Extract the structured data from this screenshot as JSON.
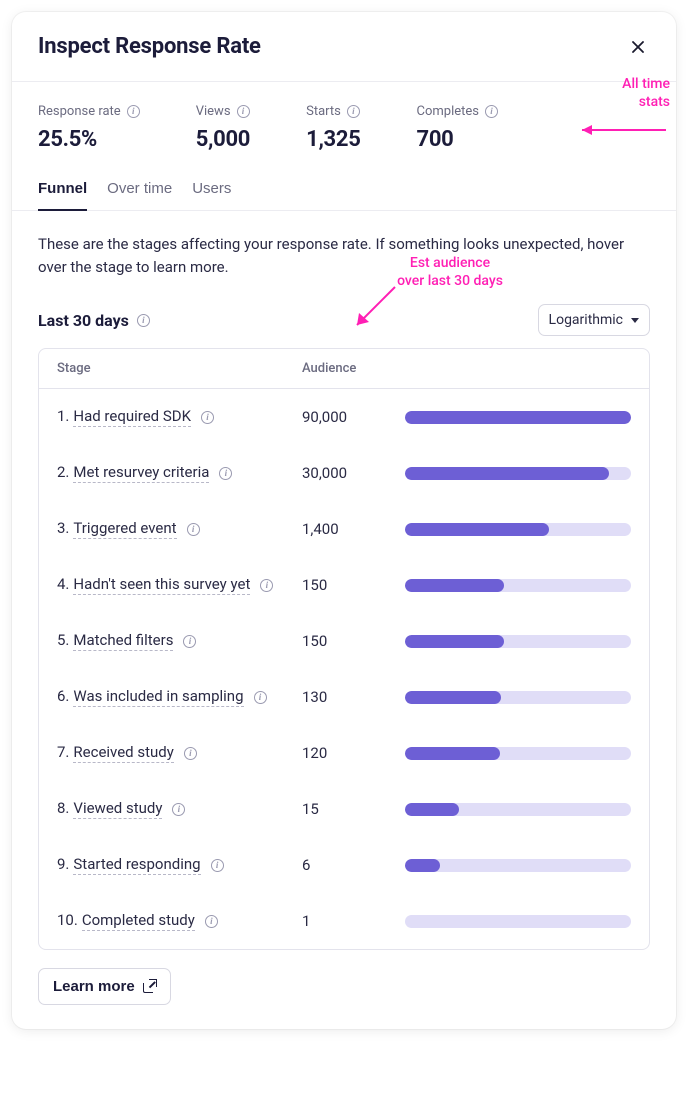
{
  "modal": {
    "title": "Inspect Response Rate",
    "tabs": [
      "Funnel",
      "Over time",
      "Users"
    ],
    "active_tab": 0
  },
  "stats": {
    "items": [
      {
        "label": "Response rate",
        "value": "25.5%"
      },
      {
        "label": "Views",
        "value": "5,000"
      },
      {
        "label": "Starts",
        "value": "1,325"
      },
      {
        "label": "Completes",
        "value": "700"
      }
    ]
  },
  "funnel": {
    "description": "These are the stages affecting your response rate. If something looks unexpected, hover over the stage to learn more.",
    "subheader": "Last 30 days",
    "scale_selected": "Logarithmic",
    "columns": {
      "stage": "Stage",
      "audience": "Audience"
    },
    "stages": [
      {
        "num": "1.",
        "name": "Had required SDK",
        "audience": "90,000",
        "audience_num": 90000
      },
      {
        "num": "2.",
        "name": "Met resurvey criteria",
        "audience": "30,000",
        "audience_num": 30000
      },
      {
        "num": "3.",
        "name": "Triggered event",
        "audience": "1,400",
        "audience_num": 1400
      },
      {
        "num": "4.",
        "name": "Hadn't seen this survey yet",
        "audience": "150",
        "audience_num": 150
      },
      {
        "num": "5.",
        "name": "Matched filters",
        "audience": "150",
        "audience_num": 150
      },
      {
        "num": "6.",
        "name": "Was included in sampling",
        "audience": "130",
        "audience_num": 130
      },
      {
        "num": "7.",
        "name": "Received study",
        "audience": "120",
        "audience_num": 120
      },
      {
        "num": "8.",
        "name": "Viewed study",
        "audience": "15",
        "audience_num": 15
      },
      {
        "num": "9.",
        "name": "Started responding",
        "audience": "6",
        "audience_num": 6
      },
      {
        "num": "10.",
        "name": "Completed study",
        "audience": "1",
        "audience_num": 1
      }
    ]
  },
  "learn_more": "Learn more",
  "annotations": {
    "all_time": "All time stats",
    "est_audience": "Est audience over last 30 days"
  },
  "colors": {
    "accent": "#6d5fd5",
    "track": "#e0ddf7",
    "anno": "#ff1fb4"
  },
  "chart_data": {
    "type": "bar",
    "orientation": "horizontal",
    "scale": "logarithmic",
    "title": "Last 30 days",
    "xlabel": "Audience",
    "ylabel": "Stage",
    "categories": [
      "Had required SDK",
      "Met resurvey criteria",
      "Triggered event",
      "Hadn't seen this survey yet",
      "Matched filters",
      "Was included in sampling",
      "Received study",
      "Viewed study",
      "Started responding",
      "Completed study"
    ],
    "values": [
      90000,
      30000,
      1400,
      150,
      150,
      130,
      120,
      15,
      6,
      1
    ]
  }
}
